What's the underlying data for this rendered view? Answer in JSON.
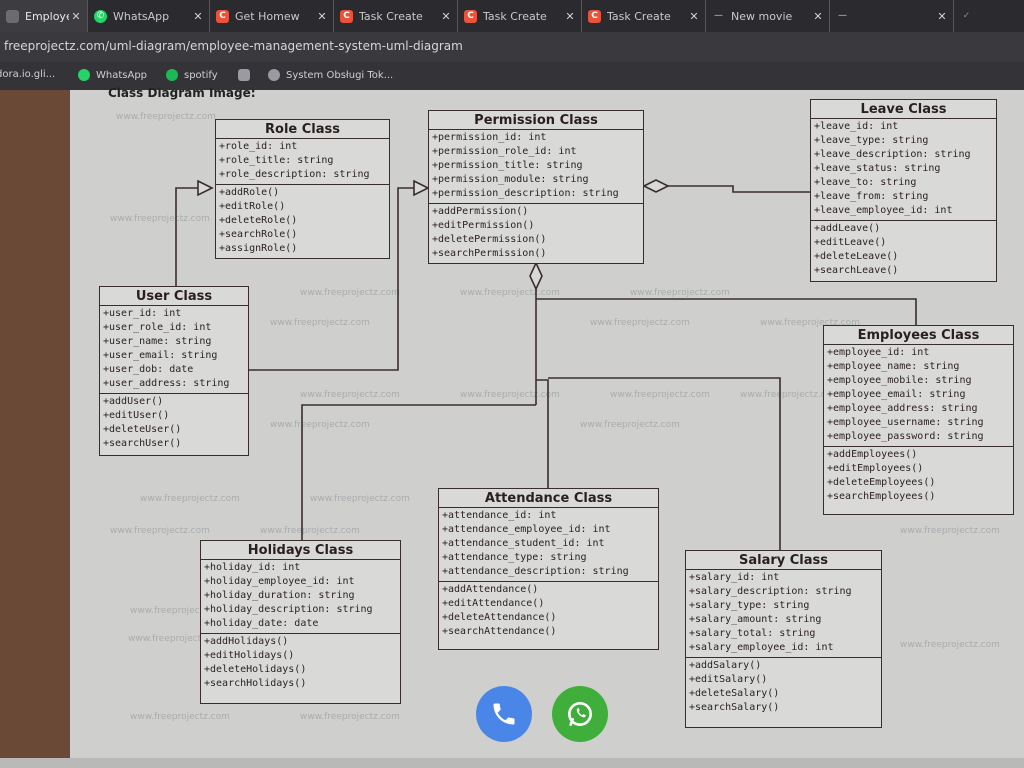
{
  "tabs": [
    {
      "label": "Employee M",
      "icon": "page-icon",
      "color": "#6b6b70"
    },
    {
      "label": "WhatsApp",
      "icon": "whatsapp-icon",
      "color": "#25d366"
    },
    {
      "label": "Get Homew",
      "icon": "c-logo-icon",
      "color": "#e8533a"
    },
    {
      "label": "Task Create",
      "icon": "c-logo-icon",
      "color": "#e8533a"
    },
    {
      "label": "Task Create",
      "icon": "c-logo-icon",
      "color": "#e8533a"
    },
    {
      "label": "Task Create",
      "icon": "c-logo-icon",
      "color": "#e8533a"
    },
    {
      "label": "New movie",
      "icon": "dash-icon",
      "color": "#8a8a90"
    }
  ],
  "address": {
    "url": "freeprojectz.com/uml-diagram/employee-management-system-uml-diagram"
  },
  "bookmarks": [
    {
      "label": "dora.io.gli...",
      "icon": "page-icon",
      "color": "#8a8a90"
    },
    {
      "label": "WhatsApp",
      "icon": "whatsapp-icon",
      "color": "#25d366"
    },
    {
      "label": "spotify",
      "icon": "spotify-icon",
      "color": "#1db954"
    },
    {
      "label": "",
      "icon": "extension-icon",
      "color": "#9a9aa0"
    },
    {
      "label": "System Obsługi Tok...",
      "icon": "globe-icon",
      "color": "#9a9aa0"
    }
  ],
  "page": {
    "heading": "Class Diagram Image:",
    "watermark": "www.freeprojectz.com"
  },
  "classes": {
    "role": {
      "title": "Role Class",
      "attributes": [
        "+role_id: int",
        "+role_title: string",
        "+role_description: string"
      ],
      "operations": [
        "+addRole()",
        "+editRole()",
        "+deleteRole()",
        "+searchRole()",
        "+assignRole()"
      ]
    },
    "permission": {
      "title": "Permission Class",
      "attributes": [
        "+permission_id: int",
        "+permission_role_id: int",
        "+permission_title: string",
        "+permission_module: string",
        "+permission_description: string"
      ],
      "operations": [
        "+addPermission()",
        "+editPermission()",
        "+deletePermission()",
        "+searchPermission()"
      ]
    },
    "leave": {
      "title": "Leave Class",
      "attributes": [
        "+leave_id: int",
        "+leave_type: string",
        "+leave_description: string",
        "+leave_status: string",
        "+leave_to: string",
        "+leave_from: string",
        "+leave_employee_id: int"
      ],
      "operations": [
        "+addLeave()",
        "+editLeave()",
        "+deleteLeave()",
        "+searchLeave()"
      ]
    },
    "user": {
      "title": "User Class",
      "attributes": [
        "+user_id: int",
        "+user_role_id: int",
        "+user_name: string",
        "+user_email: string",
        "+user_dob: date",
        "+user_address: string"
      ],
      "operations": [
        "+addUser()",
        "+editUser()",
        "+deleteUser()",
        "+searchUser()"
      ]
    },
    "employees": {
      "title": "Employees Class",
      "attributes": [
        "+employee_id: int",
        "+employee_name: string",
        "+employee_mobile: string",
        "+employee_email: string",
        "+employee_address: string",
        "+employee_username: string",
        "+employee_password: string"
      ],
      "operations": [
        "+addEmployees()",
        "+editEmployees()",
        "+deleteEmployees()",
        "+searchEmployees()"
      ]
    },
    "attendance": {
      "title": "Attendance Class",
      "attributes": [
        "+attendance_id: int",
        "+attendance_employee_id: int",
        "+attendance_student_id: int",
        "+attendance_type: string",
        "+attendance_description: string"
      ],
      "operations": [
        "+addAttendance()",
        "+editAttendance()",
        "+deleteAttendance()",
        "+searchAttendance()"
      ]
    },
    "holidays": {
      "title": "Holidays Class",
      "attributes": [
        "+holiday_id: int",
        "+holiday_employee_id: int",
        "+holiday_duration: string",
        "+holiday_description: string",
        "+holiday_date: date"
      ],
      "operations": [
        "+addHolidays()",
        "+editHolidays()",
        "+deleteHolidays()",
        "+searchHolidays()"
      ]
    },
    "salary": {
      "title": "Salary Class",
      "attributes": [
        "+salary_id: int",
        "+salary_description: string",
        "+salary_type: string",
        "+salary_amount: string",
        "+salary_total: string",
        "+salary_employee_id: int"
      ],
      "operations": [
        "+addSalary()",
        "+editSalary()",
        "+deleteSalary()",
        "+searchSalary()"
      ]
    }
  },
  "floating_buttons": [
    {
      "icon": "phone-icon",
      "color": "#4a86e8"
    },
    {
      "icon": "whatsapp-icon",
      "color": "#3fae3a"
    }
  ]
}
